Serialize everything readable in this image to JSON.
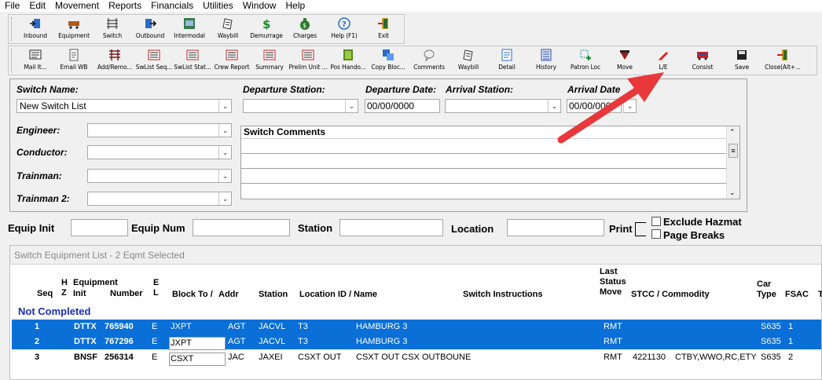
{
  "menu": [
    "File",
    "Edit",
    "Movement",
    "Reports",
    "Financials",
    "Utilities",
    "Window",
    "Help"
  ],
  "toolbar1": [
    {
      "label": "Inbound",
      "icon": "inbound-icon"
    },
    {
      "label": "Equipment",
      "icon": "equipment-icon"
    },
    {
      "label": "Switch",
      "icon": "switch-icon"
    },
    {
      "label": "Outbound",
      "icon": "outbound-icon"
    },
    {
      "label": "Intermodal",
      "icon": "intermodal-icon"
    },
    {
      "label": "Waybill",
      "icon": "waybill-icon"
    },
    {
      "label": "Demurrage",
      "icon": "dollar-icon"
    },
    {
      "label": "Charges",
      "icon": "money-bag-icon"
    },
    {
      "label": "Help (F1)",
      "icon": "help-icon"
    },
    {
      "label": "Exit",
      "icon": "exit-icon"
    }
  ],
  "toolbar2": [
    {
      "label": "Mail It...",
      "icon": "mail-icon"
    },
    {
      "label": "Email WB",
      "icon": "email-icon"
    },
    {
      "label": "Add/Remo...",
      "icon": "add-remove-icon"
    },
    {
      "label": "SwList Seq...",
      "icon": "switch-list-icon"
    },
    {
      "label": "SwList Stat...",
      "icon": "switch-list-status-icon"
    },
    {
      "label": "Crew Report",
      "icon": "crew-report-icon"
    },
    {
      "label": "Summary",
      "icon": "summary-icon"
    },
    {
      "label": "Prelim Unit ...",
      "icon": "prelim-icon"
    },
    {
      "label": "Pos Hando...",
      "icon": "handoff-icon"
    },
    {
      "label": "Copy Bloc...",
      "icon": "copy-icon"
    },
    {
      "label": "Comments",
      "icon": "comments-icon"
    },
    {
      "label": "Waybill",
      "icon": "waybill-icon"
    },
    {
      "label": "Detail",
      "icon": "detail-icon"
    },
    {
      "label": "History",
      "icon": "history-icon"
    },
    {
      "label": "Patron Loc",
      "icon": "patron-loc-icon"
    },
    {
      "label": "Move",
      "icon": "move-icon"
    },
    {
      "label": "L/E",
      "icon": "pen-icon"
    },
    {
      "label": "Consist",
      "icon": "consist-icon"
    },
    {
      "label": "Save",
      "icon": "save-icon"
    },
    {
      "label": "Close(Alt+...",
      "icon": "close-icon"
    }
  ],
  "form": {
    "switch_name_label": "Switch Name:",
    "switch_name_value": "New Switch List",
    "departure_station_label": "Departure Station:",
    "departure_date_label": "Departure Date:",
    "departure_date_value": "00/00/0000",
    "arrival_station_label": "Arrival Station:",
    "arrival_date_label": "Arrival Date",
    "arrival_date_value": "00/00/0000",
    "engineer_label": "Engineer:",
    "conductor_label": "Conductor:",
    "trainman_label": "Trainman:",
    "trainman2_label": "Trainman 2:",
    "comments_label": "Switch Comments"
  },
  "filters": {
    "equip_init_label": "Equip Init",
    "equip_num_label": "Equip Num",
    "station_label": "Station",
    "location_label": "Location",
    "print_label": "Print",
    "exclude_hazmat_label": "Exclude Hazmat",
    "page_breaks_label": "Page Breaks"
  },
  "grid": {
    "title": "Switch Equipment List - 2 Eqmt Selected",
    "headers": {
      "seq": "Seq",
      "hz": "H\nZ",
      "equipment": "Equipment",
      "init": "Init",
      "number": "Number",
      "el": "E\nL",
      "block_to": "Block To /",
      "addr": "Addr",
      "station": "Station",
      "location": "Location ID / Name",
      "instructions": "Switch Instructions",
      "last_status": "Last\nStatus\nMove",
      "stcc": "STCC / Commodity",
      "car_type": "Car\nType",
      "fsac": "FSAC",
      "t": "T"
    },
    "group": "Not Completed",
    "rows": [
      {
        "seq": "1",
        "init": "DTTX",
        "number": "765940",
        "el": "E",
        "block": "JXPT",
        "addr": "AGT",
        "station": "JACVL",
        "loc": "T3",
        "name": "HAMBURG 3",
        "move": "RMT",
        "stcc": "",
        "commodity": "",
        "car_type": "S635",
        "fsac": "1",
        "selected": true,
        "edit": false
      },
      {
        "seq": "2",
        "init": "DTTX",
        "number": "767296",
        "el": "E",
        "block": "JXPT",
        "addr": "AGT",
        "station": "JACVL",
        "loc": "T3",
        "name": "HAMBURG 3",
        "move": "RMT",
        "stcc": "",
        "commodity": "",
        "car_type": "S635",
        "fsac": "1",
        "selected": true,
        "edit": true
      },
      {
        "seq": "3",
        "init": "BNSF",
        "number": "256314",
        "el": "E",
        "block": "CSXT",
        "addr": "JAC",
        "station": "JAXEI",
        "loc": "CSXT OUT",
        "name": "CSXT OUT CSX OUTBOUNE",
        "move": "RMT",
        "stcc": "4221130",
        "commodity": "CTBY,WWO,RC,ETY",
        "car_type": "S635",
        "fsac": "2",
        "selected": false,
        "edit": true
      }
    ]
  },
  "colors": {
    "selection": "#0a6fd6",
    "group_text": "#1a2fb3",
    "arrow": "#e8383a"
  }
}
